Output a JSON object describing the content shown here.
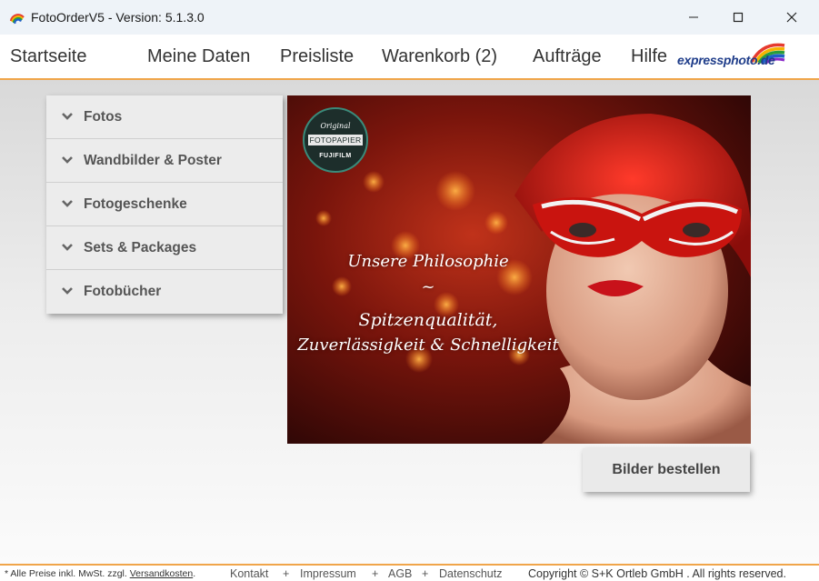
{
  "window": {
    "title": "FotoOrderV5 - Version: 5.1.3.0",
    "icon": "rainbow-app-icon"
  },
  "nav": {
    "items": [
      {
        "label": "Startseite"
      },
      {
        "label": "Meine Daten"
      },
      {
        "label": "Preisliste"
      },
      {
        "label": "Warenkorb (2)"
      },
      {
        "label": "Aufträge"
      },
      {
        "label": "Hilfe"
      }
    ],
    "logo": {
      "text_a": "express",
      "text_b": "photo",
      "text_c": ".de"
    }
  },
  "menu": {
    "items": [
      {
        "label": "Fotos"
      },
      {
        "label": "Wandbilder & Poster"
      },
      {
        "label": "Fotogeschenke"
      },
      {
        "label": "Sets & Packages"
      },
      {
        "label": "Fotobücher"
      }
    ]
  },
  "hero": {
    "badge": {
      "top": "Original",
      "middle": "FOTOPAPIER",
      "bottom": "FUJIFILM"
    },
    "lines": [
      "Unsere Philosophie",
      "~",
      "Spitzenqualität,",
      "Zuverlässigkeit & Schnelligkeit"
    ]
  },
  "order_button": {
    "label": "Bilder bestellen"
  },
  "footer": {
    "note_prefix": "* Alle Preise inkl. MwSt. zzgl.",
    "note_link": "Versandkosten",
    "note_suffix": ".",
    "links": [
      "Kontakt",
      "Impressum",
      "AGB",
      "Datenschutz"
    ],
    "separator": "+",
    "copyright": "Copyright © S+K Ortleb GmbH . All rights reserved."
  },
  "colors": {
    "accent": "#f0a54a",
    "logo_blue": "#1f3d8a"
  }
}
